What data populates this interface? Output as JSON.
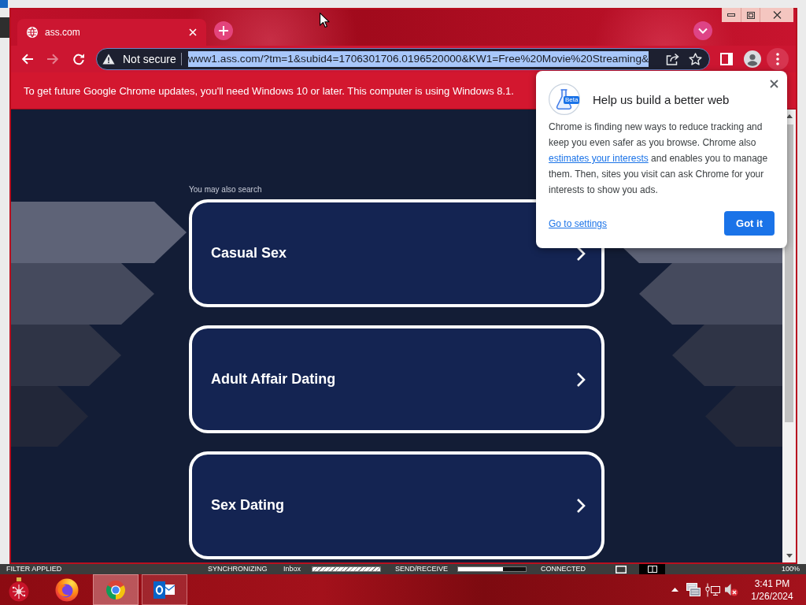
{
  "background_window": {
    "status_bar": {
      "filter": "FILTER APPLIED",
      "sync_label": "SYNCHRONIZING",
      "sync_folder": "Inbox",
      "sync_progress": {
        "busy": true
      },
      "send_receive": {
        "label": "SEND/RECEIVE",
        "level": 0.66
      },
      "connection": "CONNECTED",
      "zoom": "100%"
    }
  },
  "browser": {
    "tab": {
      "title": "ass.com"
    },
    "toolbar": {
      "back": {
        "disabled": false
      },
      "forward": {
        "disabled": true
      }
    },
    "address_bar": {
      "security": "Not secure",
      "url": "www1.ass.com/?tm=1&subid4=1706301706.0196520000&KW1=Free%20Movie%20Streaming&",
      "url_selected": true
    },
    "info_bar": "To get future Google Chrome updates, you'll need Windows 10 or later. This computer is using Windows 8.1."
  },
  "page": {
    "heading": "You may also search",
    "suggestions": [
      {
        "label": "Casual Sex"
      },
      {
        "label": "Adult Affair Dating"
      },
      {
        "label": "Sex Dating"
      }
    ]
  },
  "popup": {
    "title": "Help us build a better web",
    "badge": "Beta",
    "body_start": "Chrome is finding new ways to reduce tracking and keep you even safer as you browse. Chrome also",
    "body_link": "estimates your interests",
    "body_end": "and enables you to manage them. Then, sites you visit can ask Chrome for your interests to show you ads.",
    "settings_link": "Go to settings",
    "confirm_button": "Got it"
  },
  "taskbar": {
    "apps": [
      {
        "open": false,
        "selected": false
      },
      {
        "open": true,
        "selected": true
      },
      {
        "open": true,
        "selected": false
      }
    ],
    "clock": {
      "time": "3:41 PM",
      "date": "1/26/2024"
    }
  }
}
